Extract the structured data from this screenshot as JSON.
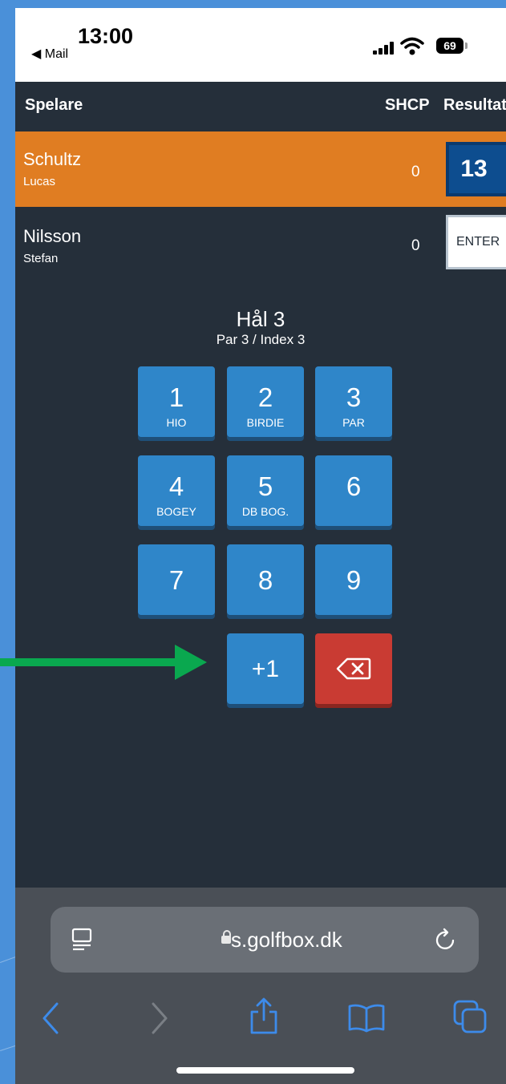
{
  "status_bar": {
    "time": "13:00",
    "back_app": "◀ Mail",
    "battery": "69"
  },
  "header": {
    "player_col": "Spelare",
    "shcp_col": "SHCP",
    "result_col": "Resultat"
  },
  "players": [
    {
      "last_name": "Schultz",
      "first_name": "Lucas",
      "shcp": "0",
      "result": "13",
      "active": true
    },
    {
      "last_name": "Nilsson",
      "first_name": "Stefan",
      "shcp": "0",
      "result": "ENTER",
      "active": false
    }
  ],
  "hole": {
    "title": "Hål 3",
    "subtitle": "Par 3 / Index 3"
  },
  "keypad": {
    "keys": [
      {
        "num": "1",
        "label": "HIO"
      },
      {
        "num": "2",
        "label": "BIRDIE"
      },
      {
        "num": "3",
        "label": "PAR"
      },
      {
        "num": "4",
        "label": "BOGEY"
      },
      {
        "num": "5",
        "label": "DB BOG."
      },
      {
        "num": "6",
        "label": ""
      },
      {
        "num": "7",
        "label": ""
      },
      {
        "num": "8",
        "label": ""
      },
      {
        "num": "9",
        "label": ""
      },
      {
        "num": "+1",
        "label": ""
      }
    ],
    "delete_icon": "backspace-icon"
  },
  "annotation": {
    "arrow_color": "#0aa84f",
    "arrow_icon": "arrow-right-icon"
  },
  "browser": {
    "url": "s.golfbox.dk"
  },
  "colors": {
    "active_row": "#e07d22",
    "key_blue": "#2f86c9",
    "delete_red": "#c93b33",
    "score_box": "#0d4d8f"
  }
}
